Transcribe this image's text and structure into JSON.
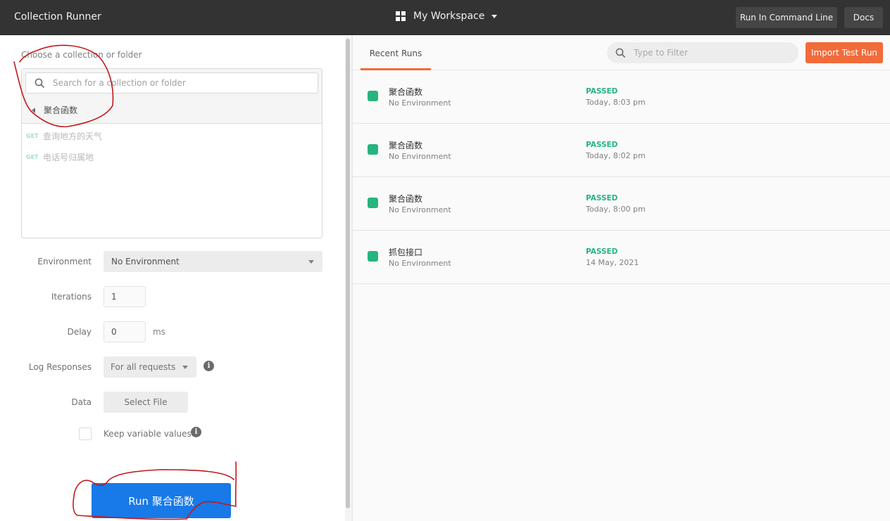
{
  "header": {
    "app_title": "Collection Runner",
    "workspace": "My Workspace",
    "run_command_line": "Run In Command Line",
    "docs": "Docs"
  },
  "left": {
    "choose_label": "Choose a collection or folder",
    "search_placeholder": "Search for a collection or folder",
    "current_collection": "聚合函数",
    "requests": [
      {
        "method": "GET",
        "name": "查询地方的天气"
      },
      {
        "method": "GET",
        "name": "电话号归属地"
      }
    ],
    "environment": {
      "label": "Environment",
      "value": "No Environment"
    },
    "iterations": {
      "label": "Iterations",
      "value": "1"
    },
    "delay": {
      "label": "Delay",
      "value": "0",
      "unit": "ms"
    },
    "log_responses": {
      "label": "Log Responses",
      "value": "For all requests"
    },
    "data": {
      "label": "Data",
      "button": "Select File"
    },
    "keep_variable_values": {
      "label": "Keep variable values",
      "checked": false
    },
    "run_button": "Run 聚合函数"
  },
  "right": {
    "tabs": [
      {
        "label": "Recent Runs",
        "active": true
      }
    ],
    "filter_placeholder": "Type to Filter",
    "import_button": "Import Test Run",
    "runs": [
      {
        "name": "聚合函数",
        "environment": "No Environment",
        "status": "PASSED",
        "time": "Today, 8:03 pm"
      },
      {
        "name": "聚合函数",
        "environment": "No Environment",
        "status": "PASSED",
        "time": "Today, 8:02 pm"
      },
      {
        "name": "聚合函数",
        "environment": "No Environment",
        "status": "PASSED",
        "time": "Today, 8:00 pm"
      },
      {
        "name": "抓包接口",
        "environment": "No Environment",
        "status": "PASSED",
        "time": "14 May, 2021"
      }
    ]
  },
  "colors": {
    "header_bg": "#333333",
    "accent_orange": "#f26b3a",
    "run_blue": "#1879e8",
    "passed_green": "#26b47f",
    "annotation_red": "#c0181c"
  }
}
